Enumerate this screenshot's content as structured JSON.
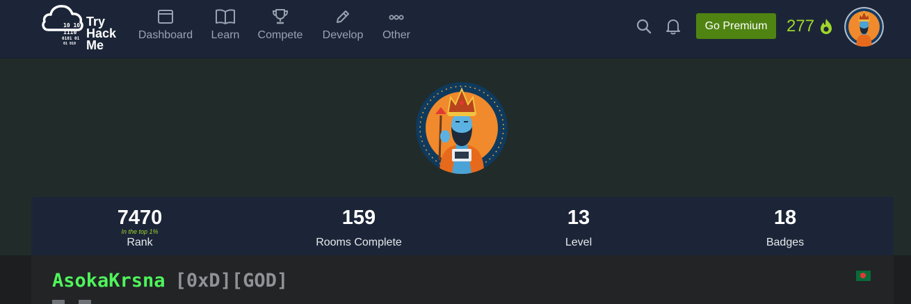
{
  "brand": {
    "word_lines": [
      "Try",
      "Hack",
      "Me"
    ],
    "bits_lines": [
      "10  10",
      "1110",
      "0101  01",
      "01      010"
    ]
  },
  "nav": {
    "items": [
      {
        "label": "Dashboard",
        "icon": "window-icon"
      },
      {
        "label": "Learn",
        "icon": "book-icon"
      },
      {
        "label": "Compete",
        "icon": "trophy-icon"
      },
      {
        "label": "Develop",
        "icon": "pencil-icon"
      },
      {
        "label": "Other",
        "icon": "more-dots-icon"
      }
    ],
    "premium_label": "Go Premium",
    "streak_count": "277",
    "icons": {
      "search": "search-icon",
      "notifications": "bell-icon",
      "streak": "flame-icon"
    }
  },
  "stats": [
    {
      "value": "7470",
      "sub": "In the top 1%",
      "label": "Rank"
    },
    {
      "value": "159",
      "sub": "",
      "label": "Rooms Complete"
    },
    {
      "value": "13",
      "sub": "",
      "label": "Level"
    },
    {
      "value": "18",
      "sub": "",
      "label": "Badges"
    }
  ],
  "profile": {
    "username": "AsokaKrsna",
    "tag": "[0xD][GOD]",
    "flag": "bangladesh-flag"
  },
  "colors": {
    "nav_bg": "#1c2538",
    "page_bg": "#212c2a",
    "accent_green": "#9fd62a",
    "premium_button": "#4f8412",
    "username_green": "#4ff55a"
  }
}
